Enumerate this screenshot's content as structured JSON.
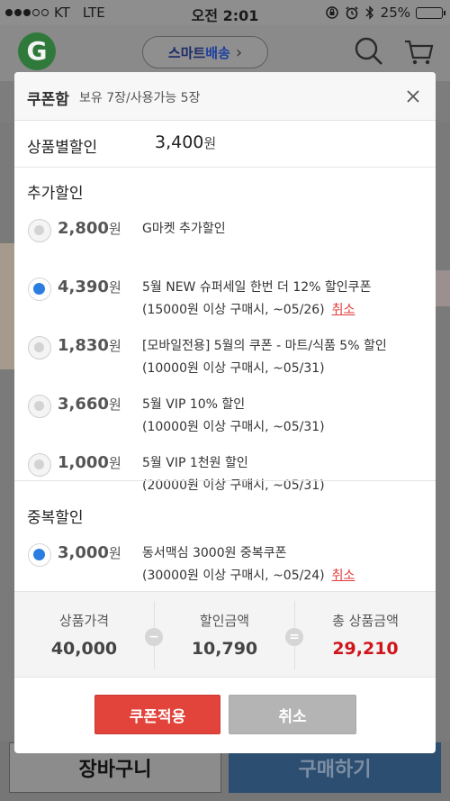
{
  "status_bar": {
    "carrier": "KT",
    "network": "LTE",
    "time": "오전 2:01",
    "battery_percent": "25%",
    "battery_level": 0.25
  },
  "app_header": {
    "logo_letter": "G",
    "smart_delivery_a": "스마트",
    "smart_delivery_b": "배송",
    "smart_delivery_chevron": "›",
    "brand_blue": "#1c3fa0",
    "logo_green": "#2f7a3a"
  },
  "bottom_bar": {
    "cart_label": "장바구니",
    "buy_label": "구매하기"
  },
  "modal": {
    "title": "쿠폰함",
    "subtitle": "보유 7장/사용가능 5장",
    "product_discount": {
      "label": "상품별할인",
      "amount": "3,400",
      "unit": "원"
    },
    "extra_section_title": "추가할인",
    "extra_coupons": [
      {
        "amount": "2,800",
        "unit": "원",
        "name": "G마켓 추가할인",
        "condition": "",
        "selected": false,
        "cancel_label": ""
      },
      {
        "amount": "4,390",
        "unit": "원",
        "name": "5월 NEW 슈퍼세일 한번 더 12% 할인쿠폰",
        "condition": "(15000원 이상 구매시, ~05/26)",
        "selected": true,
        "cancel_label": "취소"
      },
      {
        "amount": "1,830",
        "unit": "원",
        "name": "[모바일전용] 5월의 쿠폰 - 마트/식품 5% 할인",
        "condition": "(10000원 이상 구매시, ~05/31)",
        "selected": false,
        "cancel_label": ""
      },
      {
        "amount": "3,660",
        "unit": "원",
        "name": "5월 VIP 10% 할인",
        "condition": "(10000원 이상 구매시, ~05/31)",
        "selected": false,
        "cancel_label": ""
      },
      {
        "amount": "1,000",
        "unit": "원",
        "name": "5월 VIP 1천원 할인",
        "condition": "(20000원 이상 구매시, ~05/31)",
        "selected": false,
        "cancel_label": ""
      }
    ],
    "dup_section_title": "중복할인",
    "dup_coupons": [
      {
        "amount": "3,000",
        "unit": "원",
        "name": "동서맥심 3000원 중복쿠폰",
        "condition": "(30000원 이상 구매시, ~05/24)",
        "selected": true,
        "cancel_label": "취소"
      }
    ],
    "summary": {
      "price_label": "상품가격",
      "price_value": "40,000",
      "discount_label": "할인금액",
      "discount_value": "10,790",
      "total_label": "총 상품금액",
      "total_value": "29,210",
      "minus_symbol": "−",
      "equals_symbol": "=",
      "total_color": "#d0141b"
    },
    "apply_button": "쿠폰적용",
    "cancel_button": "취소",
    "accent_red": "#e2433b",
    "radio_blue": "#2a7de1"
  }
}
